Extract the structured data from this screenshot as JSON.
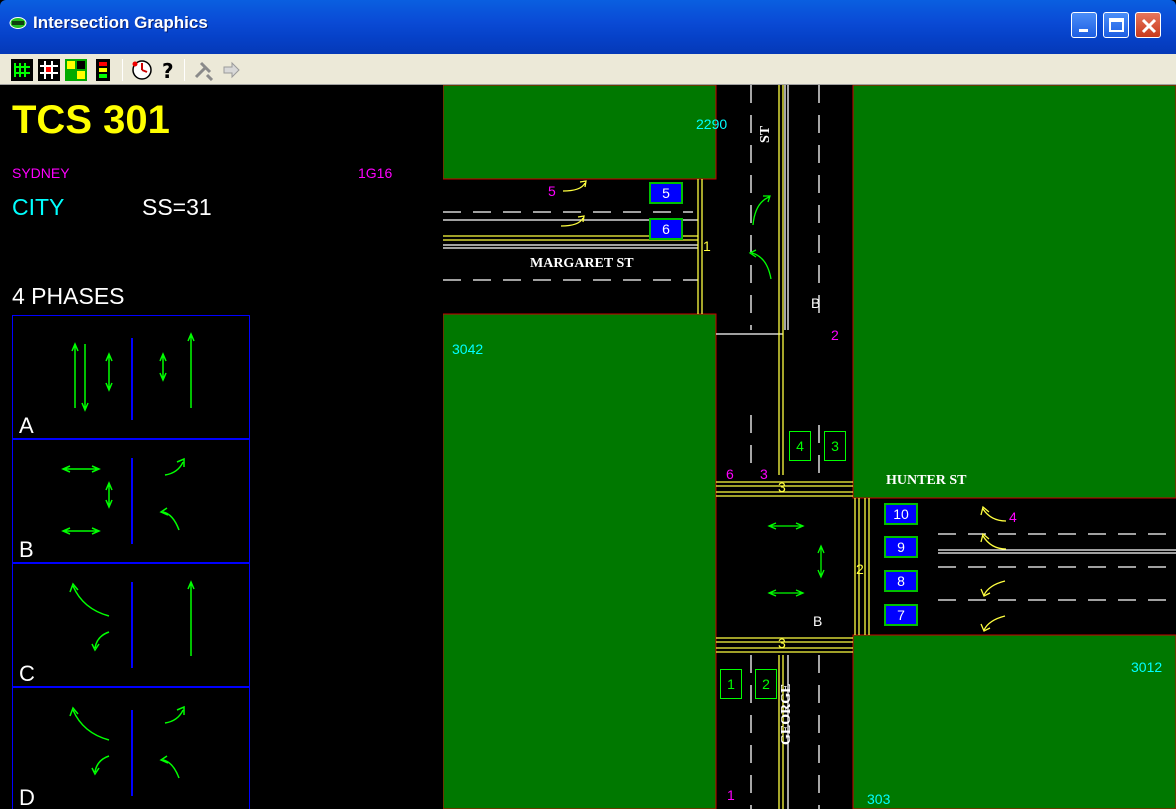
{
  "window": {
    "title": "Intersection Graphics"
  },
  "toolbar": {
    "buttons": [
      "phases-icon",
      "grid-icon",
      "split-icon",
      "signal-icon",
      "clock-icon",
      "help-icon",
      "tools-icon",
      "arrow-icon"
    ]
  },
  "info": {
    "tcs_label": "TCS 301",
    "region": "SYDNEY",
    "code": "1G16",
    "area": "CITY",
    "ss": "SS=31",
    "phases_label": "4 PHASES"
  },
  "phases": [
    {
      "letter": "A"
    },
    {
      "letter": "B"
    },
    {
      "letter": "C"
    },
    {
      "letter": "D"
    }
  ],
  "map": {
    "block_labels": {
      "nw": "2290",
      "w": "3042",
      "se": "3012",
      "s": "303"
    },
    "streets": {
      "margaret": "MARGARET ST",
      "hunter": "HUNTER ST",
      "george": "GEORGE",
      "st_top": "ST"
    },
    "detectors": {
      "d5": "5",
      "d6": "6",
      "d10": "10",
      "d9": "9",
      "d8": "8",
      "d7": "7"
    },
    "ped_detectors": {
      "p4": "4",
      "p3": "3",
      "p1": "1",
      "p2": "2"
    },
    "markers": {
      "m5": "5",
      "m2": "2",
      "m4": "4",
      "m6": "6",
      "m3a": "3",
      "m1": "1",
      "y1": "1",
      "y3a": "3",
      "y3b": "3",
      "y2": "2",
      "b1": "B",
      "b2": "B"
    }
  },
  "colors": {
    "grass": "#007800",
    "road": "#000000",
    "lane_line": "#ffffff",
    "kerb": "#ffff40",
    "arrow": "#00ff00",
    "boundary": "#cc0000",
    "titlebar": "#0a4bd6"
  }
}
